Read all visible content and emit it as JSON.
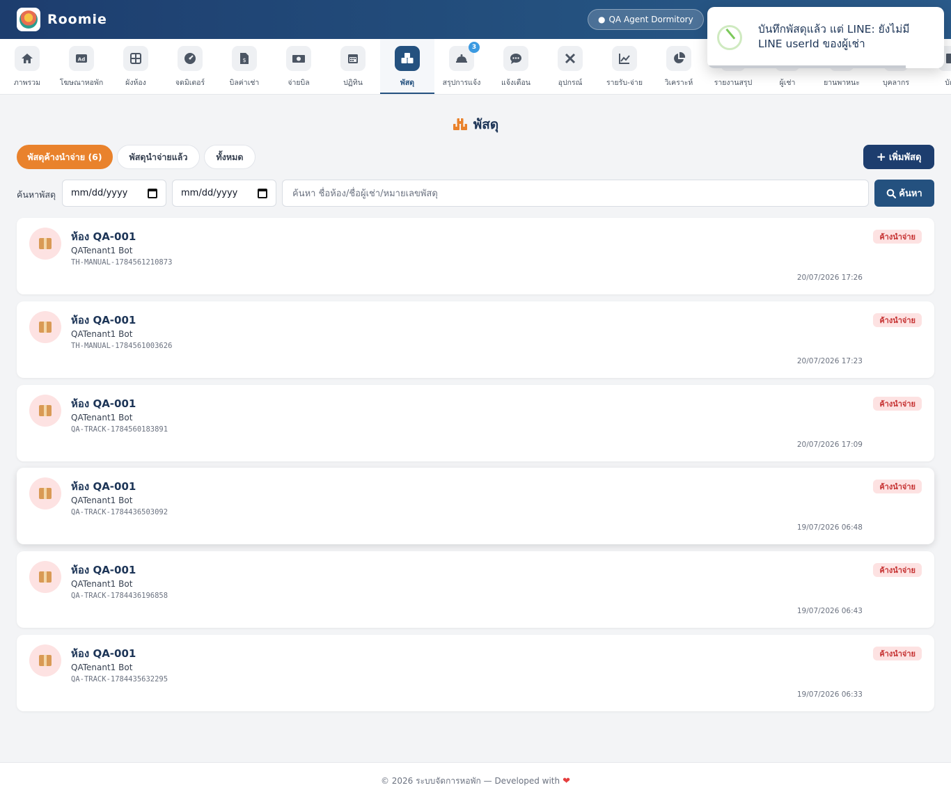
{
  "app": {
    "name": "Roomie",
    "dormitory": "QA Agent Dormitory"
  },
  "nav": [
    {
      "label": "ภาพรวม",
      "icon": "home-icon"
    },
    {
      "label": "โฆษณาหอพัก",
      "icon": "ad-icon"
    },
    {
      "label": "ผังห้อง",
      "icon": "grid-icon"
    },
    {
      "label": "จดมิเตอร์",
      "icon": "gauge-icon"
    },
    {
      "label": "บิลค่าเช่า",
      "icon": "invoice-icon"
    },
    {
      "label": "จ่ายบิล",
      "icon": "money-icon"
    },
    {
      "label": "ปฏิทิน",
      "icon": "calendar-icon"
    },
    {
      "label": "พัสดุ",
      "icon": "boxes-icon",
      "active": true
    },
    {
      "label": "สรุปการแจ้ง",
      "icon": "bell-icon",
      "badge": "3"
    },
    {
      "label": "แจ้งเตือน",
      "icon": "chat-icon"
    },
    {
      "label": "อุปกรณ์",
      "icon": "tools-icon"
    },
    {
      "label": "รายรับ-จ่าย",
      "icon": "chart-line-icon"
    },
    {
      "label": "วิเคราะห์",
      "icon": "pie-icon"
    },
    {
      "label": "รายงานสรุป",
      "icon": "report-icon"
    },
    {
      "label": "ผู้เช่า",
      "icon": "users-icon"
    },
    {
      "label": "ยานพาหนะ",
      "icon": "car-icon"
    },
    {
      "label": "บุคลากร",
      "icon": "staff-icon"
    },
    {
      "label": "บัญ",
      "icon": "book-icon"
    }
  ],
  "toast": {
    "message": "บันทึกพัสดุแล้ว แต่ LINE: ยังไม่มี LINE userId ของผู้เช่า"
  },
  "page": {
    "title": "พัสดุ"
  },
  "tabs": {
    "pending": "พัสดุค้างนำจ่าย (6)",
    "delivered": "พัสดุนำจ่ายแล้ว",
    "all": "ทั้งหมด"
  },
  "actions": {
    "add": "เพิ่มพัสดุ",
    "search": "ค้นหา"
  },
  "search": {
    "label": "ค้นหาพัสดุ",
    "date_from": "mm/dd/yyyy",
    "date_to": "mm/dd/yyyy",
    "placeholder": "ค้นหา ชื่อห้อง/ชื่อผู้เช่า/หมายเลขพัสดุ"
  },
  "parcels": [
    {
      "room": "ห้อง QA-001",
      "tenant": "QATenant1 Bot",
      "tracking": "TH-MANUAL-1784561210873",
      "status": "ค้างนำจ่าย",
      "date": "20/07/2026 17:26"
    },
    {
      "room": "ห้อง QA-001",
      "tenant": "QATenant1 Bot",
      "tracking": "TH-MANUAL-1784561003626",
      "status": "ค้างนำจ่าย",
      "date": "20/07/2026 17:23"
    },
    {
      "room": "ห้อง QA-001",
      "tenant": "QATenant1 Bot",
      "tracking": "QA-TRACK-1784560183891",
      "status": "ค้างนำจ่าย",
      "date": "20/07/2026 17:09"
    },
    {
      "room": "ห้อง QA-001",
      "tenant": "QATenant1 Bot",
      "tracking": "QA-TRACK-1784436503092",
      "status": "ค้างนำจ่าย",
      "date": "19/07/2026 06:48"
    },
    {
      "room": "ห้อง QA-001",
      "tenant": "QATenant1 Bot",
      "tracking": "QA-TRACK-1784436196858",
      "status": "ค้างนำจ่าย",
      "date": "19/07/2026 06:43"
    },
    {
      "room": "ห้อง QA-001",
      "tenant": "QATenant1 Bot",
      "tracking": "QA-TRACK-1784435632295",
      "status": "ค้างนำจ่าย",
      "date": "19/07/2026 06:33"
    }
  ],
  "footer": {
    "text": "© 2026 ระบบจัดการหอพัก — Developed with"
  }
}
